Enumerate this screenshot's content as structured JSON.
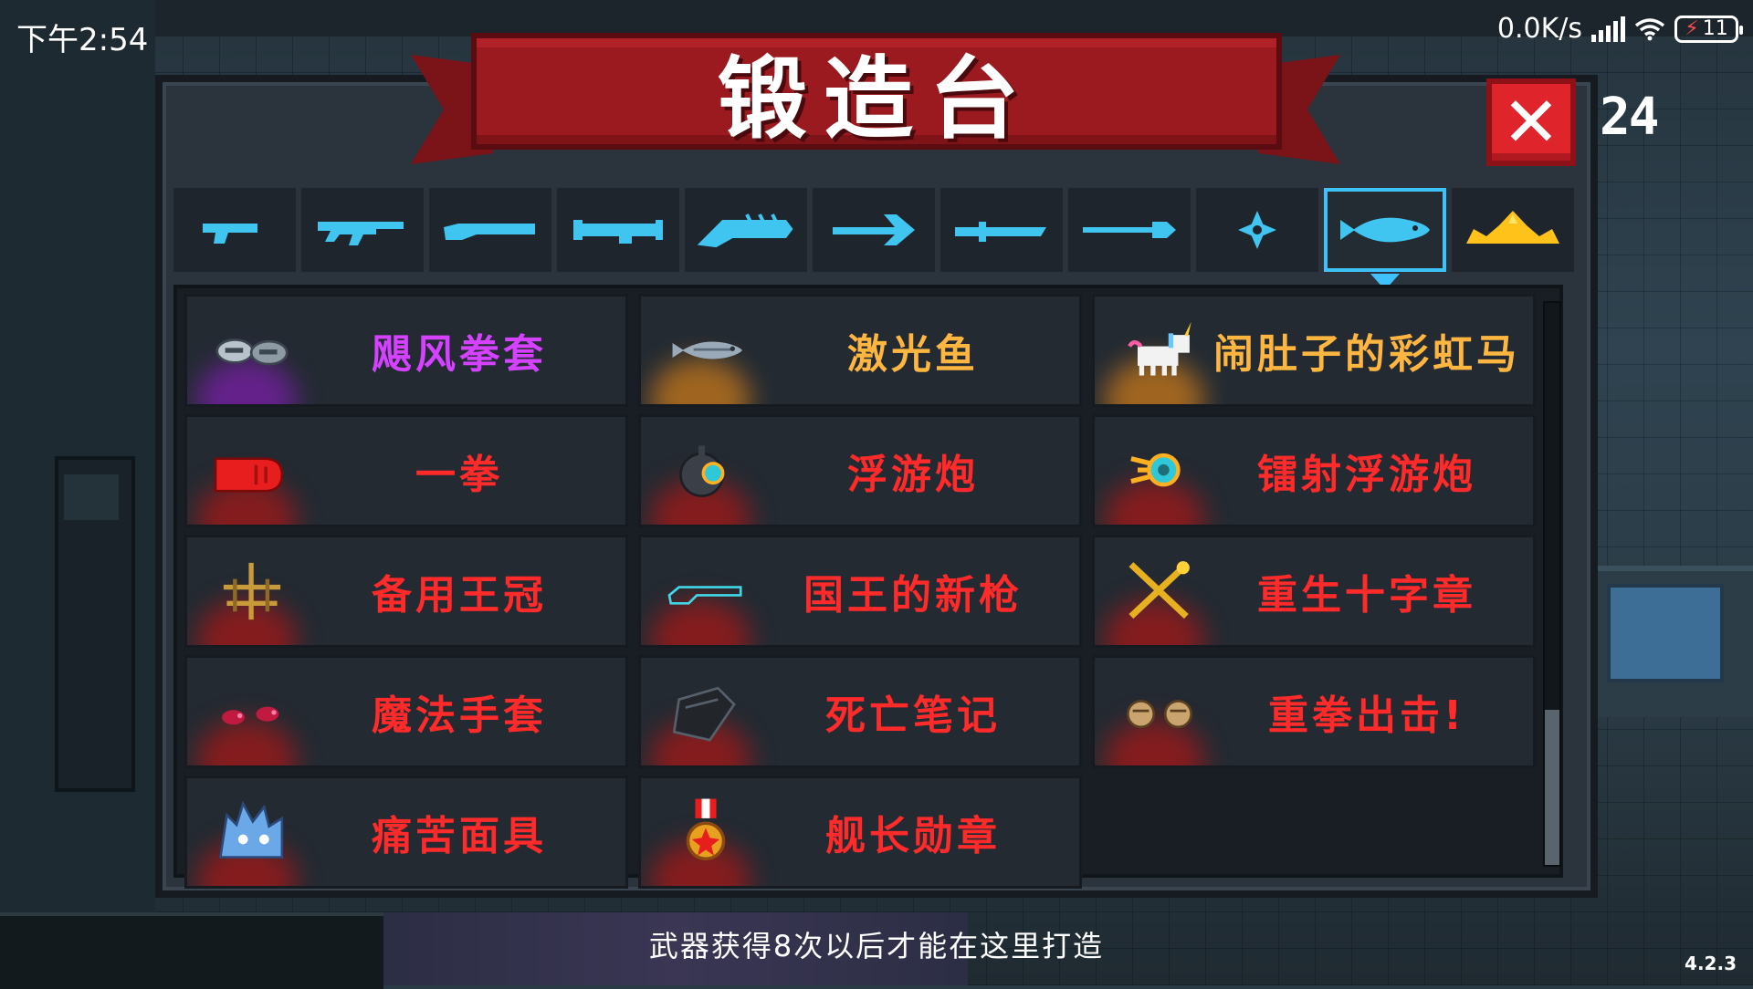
{
  "status_bar": {
    "time": "下午2:54",
    "net_speed": "0.0K/s",
    "battery": "11"
  },
  "gem_count": "24",
  "forge": {
    "title": "锻造台",
    "close_label": "✕"
  },
  "tabs": [
    {
      "icon": "pistol-icon",
      "active": false
    },
    {
      "icon": "rifle-icon",
      "active": false
    },
    {
      "icon": "shotgun-icon",
      "active": false
    },
    {
      "icon": "launcher-icon",
      "active": false
    },
    {
      "icon": "staff-icon",
      "active": false
    },
    {
      "icon": "bow-icon",
      "active": false
    },
    {
      "icon": "melee-icon",
      "active": false
    },
    {
      "icon": "spear-icon",
      "active": false
    },
    {
      "icon": "shuriken-icon",
      "active": false
    },
    {
      "icon": "fish-icon",
      "active": true
    },
    {
      "icon": "crown-icon",
      "active": false
    }
  ],
  "items": [
    {
      "name": "飓风拳套",
      "color": "#d442ff",
      "glow": "#7a1fa8",
      "icon": "gauntlet-pair-icon"
    },
    {
      "name": "激光鱼",
      "color": "#ffb640",
      "glow": "#c9791a",
      "icon": "laser-fish-icon"
    },
    {
      "name": "闹肚子的彩虹马",
      "color": "#ffb640",
      "glow": "#c9791a",
      "icon": "unicorn-icon"
    },
    {
      "name": "一拳",
      "color": "#ff2a2a",
      "glow": "#a51818",
      "icon": "red-fist-icon"
    },
    {
      "name": "浮游炮",
      "color": "#ff2a2a",
      "glow": "#a51818",
      "icon": "drone-bomb-icon"
    },
    {
      "name": "镭射浮游炮",
      "color": "#ff2a2a",
      "glow": "#a51818",
      "icon": "laser-drone-icon"
    },
    {
      "name": "备用王冠",
      "color": "#ff2a2a",
      "glow": "#a51818",
      "icon": "spare-crown-icon"
    },
    {
      "name": "国王的新枪",
      "color": "#ff2a2a",
      "glow": "#a51818",
      "icon": "invisible-gun-icon"
    },
    {
      "name": "重生十字章",
      "color": "#ff2a2a",
      "glow": "#a51818",
      "icon": "rebirth-cross-icon"
    },
    {
      "name": "魔法手套",
      "color": "#ff2a2a",
      "glow": "#a51818",
      "icon": "magic-glove-icon"
    },
    {
      "name": "死亡笔记",
      "color": "#ff2a2a",
      "glow": "#a51818",
      "icon": "death-note-icon"
    },
    {
      "name": "重拳出击!",
      "color": "#ff2a2a",
      "glow": "#a51818",
      "icon": "fists-icon"
    },
    {
      "name": "痛苦面具",
      "color": "#ff2a2a",
      "glow": "#a51818",
      "icon": "pain-mask-icon"
    },
    {
      "name": "舰长勋章",
      "color": "#ff2a2a",
      "glow": "#a51818",
      "icon": "captain-medal-icon"
    }
  ],
  "scroll_position": 1.0,
  "hint": "武器获得8次以后才能在这里打造",
  "version": "4.2.3"
}
